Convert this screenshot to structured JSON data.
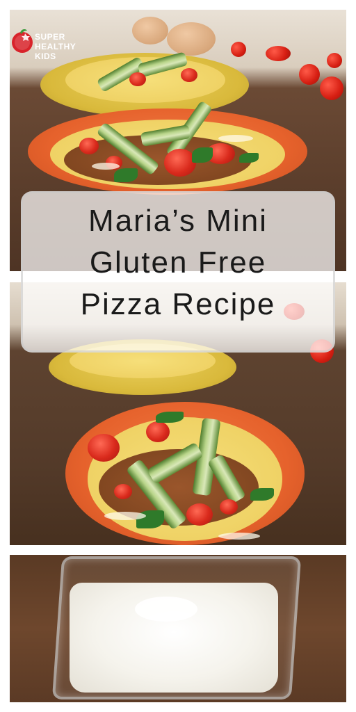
{
  "logo": {
    "line1": "SUPER",
    "line2": "HEALTHY",
    "line3": "KIDS",
    "brand_color": "#d8232a"
  },
  "title": {
    "line1": "Maria’s Mini",
    "line2": "Gluten Free",
    "line3": "Pizza Recipe"
  },
  "colors": {
    "orange_plate": "#e6622c",
    "yellow_plate": "#d9b93b",
    "wood": "#5a3d2b"
  }
}
